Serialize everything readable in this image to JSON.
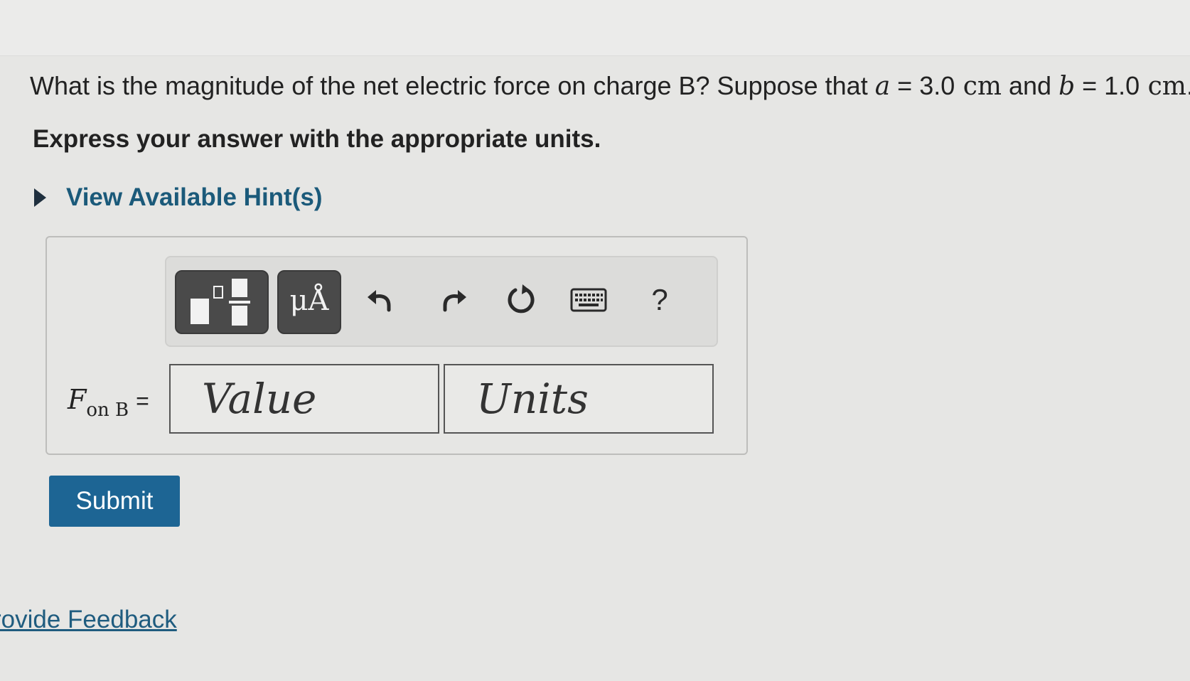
{
  "question": {
    "prefix": "What is the magnitude of the net electric force on charge B? Suppose that ",
    "var_a": "a",
    "eq_a": " = ",
    "num_a": "3.0",
    "unit_a": " cm",
    "and": " and ",
    "var_b": "b",
    "eq_b": " = ",
    "num_b": "1.0",
    "unit_b": " cm",
    "period": "."
  },
  "instruction": "Express your answer with the appropriate units.",
  "hint": {
    "label": "View Available Hint(s)"
  },
  "toolbar": {
    "units_label": "μÅ",
    "help_label": "?",
    "icons": [
      "templates-icon",
      "units-icon",
      "undo-icon",
      "redo-icon",
      "reset-icon",
      "keyboard-icon",
      "help-icon"
    ]
  },
  "answer": {
    "var": "F",
    "subscript": "on B",
    "equals": "=",
    "value_placeholder": "Value",
    "units_placeholder": "Units"
  },
  "submit_label": "Submit",
  "feedback_label": "rovide Feedback",
  "colors": {
    "background": "#e6e6e4",
    "link": "#1b5a7a",
    "submit": "#1d6594",
    "toolbar_button": "#4a4a4a"
  }
}
